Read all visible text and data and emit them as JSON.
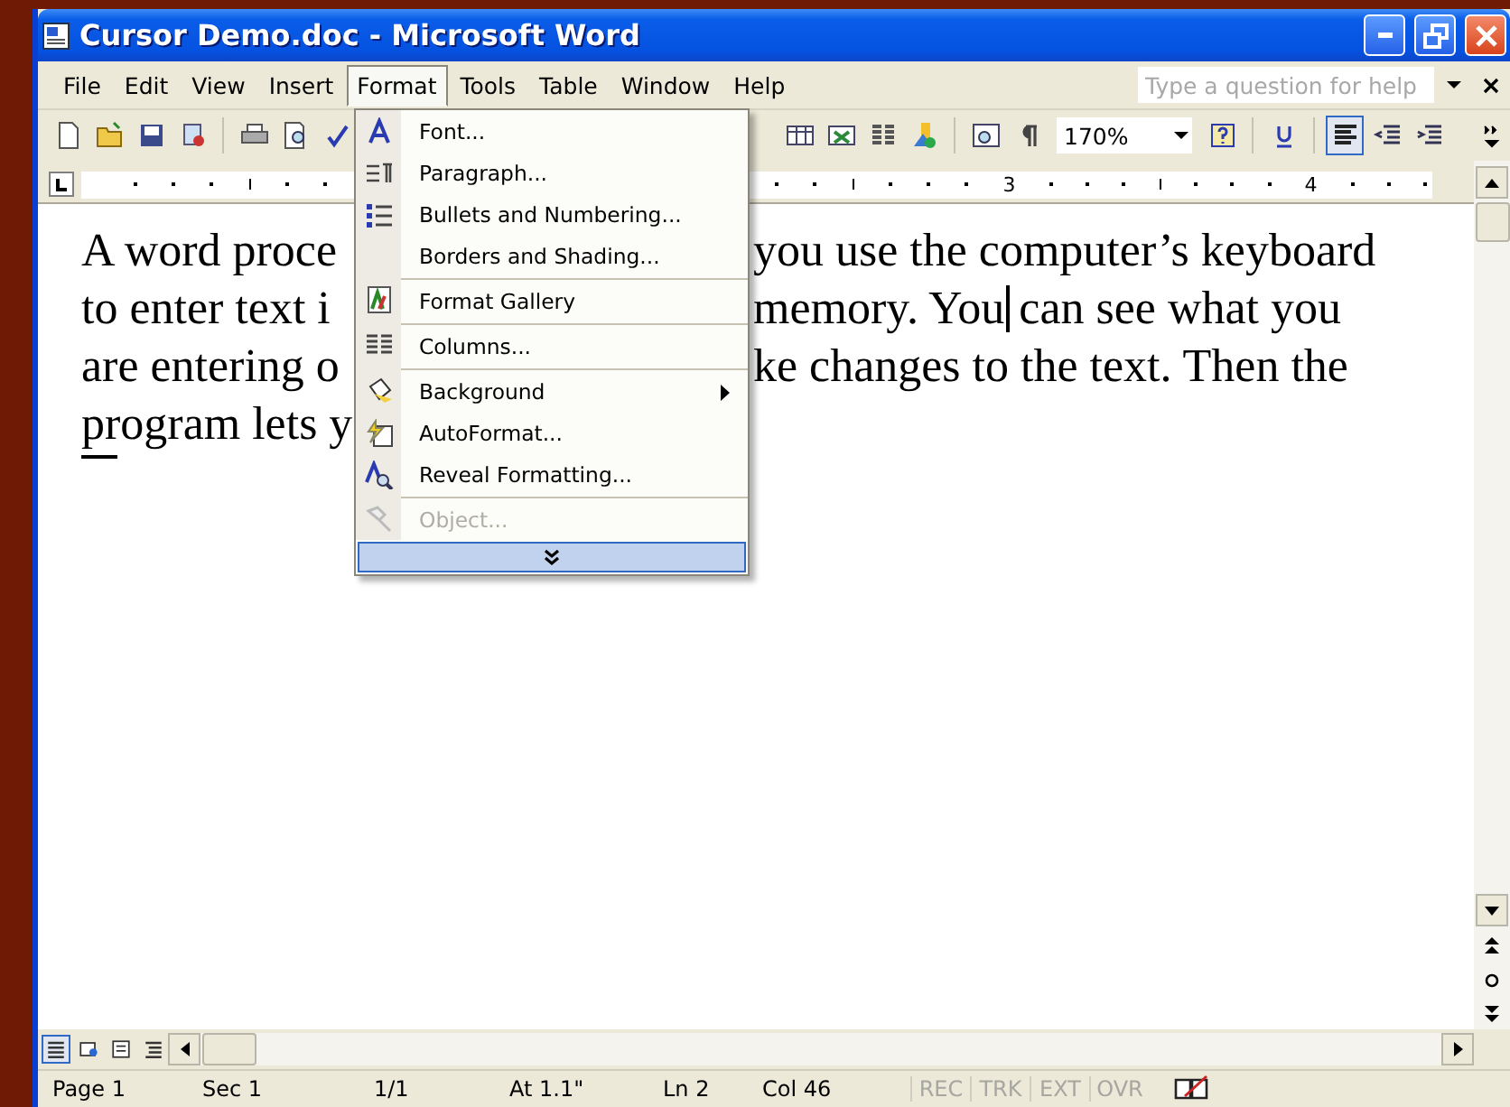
{
  "window": {
    "title": "Cursor Demo.doc - Microsoft Word"
  },
  "menu_bar": [
    {
      "label": "File",
      "selected": false
    },
    {
      "label": "Edit",
      "selected": false
    },
    {
      "label": "View",
      "selected": false
    },
    {
      "label": "Insert",
      "selected": false
    },
    {
      "label": "Format",
      "selected": true
    },
    {
      "label": "Tools",
      "selected": false
    },
    {
      "label": "Table",
      "selected": false
    },
    {
      "label": "Window",
      "selected": false
    },
    {
      "label": "Help",
      "selected": false
    }
  ],
  "help_box": {
    "placeholder": "Type a question for help"
  },
  "toolbar": {
    "zoom": "170%",
    "align_left_pressed": true
  },
  "ruler": {
    "numbers": [
      "3",
      "4"
    ]
  },
  "document": {
    "lines": [
      {
        "left": "A word proce",
        "right": "you use the computer’s keyboard"
      },
      {
        "left": "to enter text i",
        "right": "memory. You",
        "after_caret": "can see what you"
      },
      {
        "left": "are entering o",
        "right": "ke changes to the text. Then the"
      },
      {
        "left": "program lets y"
      }
    ]
  },
  "format_menu": {
    "items": [
      {
        "label": "Font...",
        "disabled": false,
        "submenu": false,
        "separator_before": false
      },
      {
        "label": "Paragraph...",
        "disabled": false,
        "submenu": false,
        "separator_before": false
      },
      {
        "label": "Bullets and Numbering...",
        "disabled": false,
        "submenu": false,
        "separator_before": false
      },
      {
        "label": "Borders and Shading...",
        "disabled": false,
        "submenu": false,
        "separator_before": false
      },
      {
        "label": "Format Gallery",
        "disabled": false,
        "submenu": false,
        "separator_before": true
      },
      {
        "label": "Columns...",
        "disabled": false,
        "submenu": false,
        "separator_before": true
      },
      {
        "label": "Background",
        "disabled": false,
        "submenu": true,
        "separator_before": true
      },
      {
        "label": "AutoFormat...",
        "disabled": false,
        "submenu": false,
        "separator_before": false
      },
      {
        "label": "Reveal Formatting...",
        "disabled": false,
        "submenu": false,
        "separator_before": false
      },
      {
        "label": "Object...",
        "disabled": true,
        "submenu": false,
        "separator_before": true
      }
    ]
  },
  "view_buttons": [
    {
      "selected": true
    },
    {
      "selected": false
    },
    {
      "selected": false
    },
    {
      "selected": false
    }
  ],
  "status_bar": {
    "fields": [
      "Page 1",
      "Sec 1",
      "1/1",
      "At 1.1\"",
      "Ln 2",
      "Col 46"
    ],
    "modes": [
      {
        "label": "REC",
        "active": false
      },
      {
        "label": "TRK",
        "active": false
      },
      {
        "label": "EXT",
        "active": false
      },
      {
        "label": "OVR",
        "active": false
      }
    ]
  }
}
